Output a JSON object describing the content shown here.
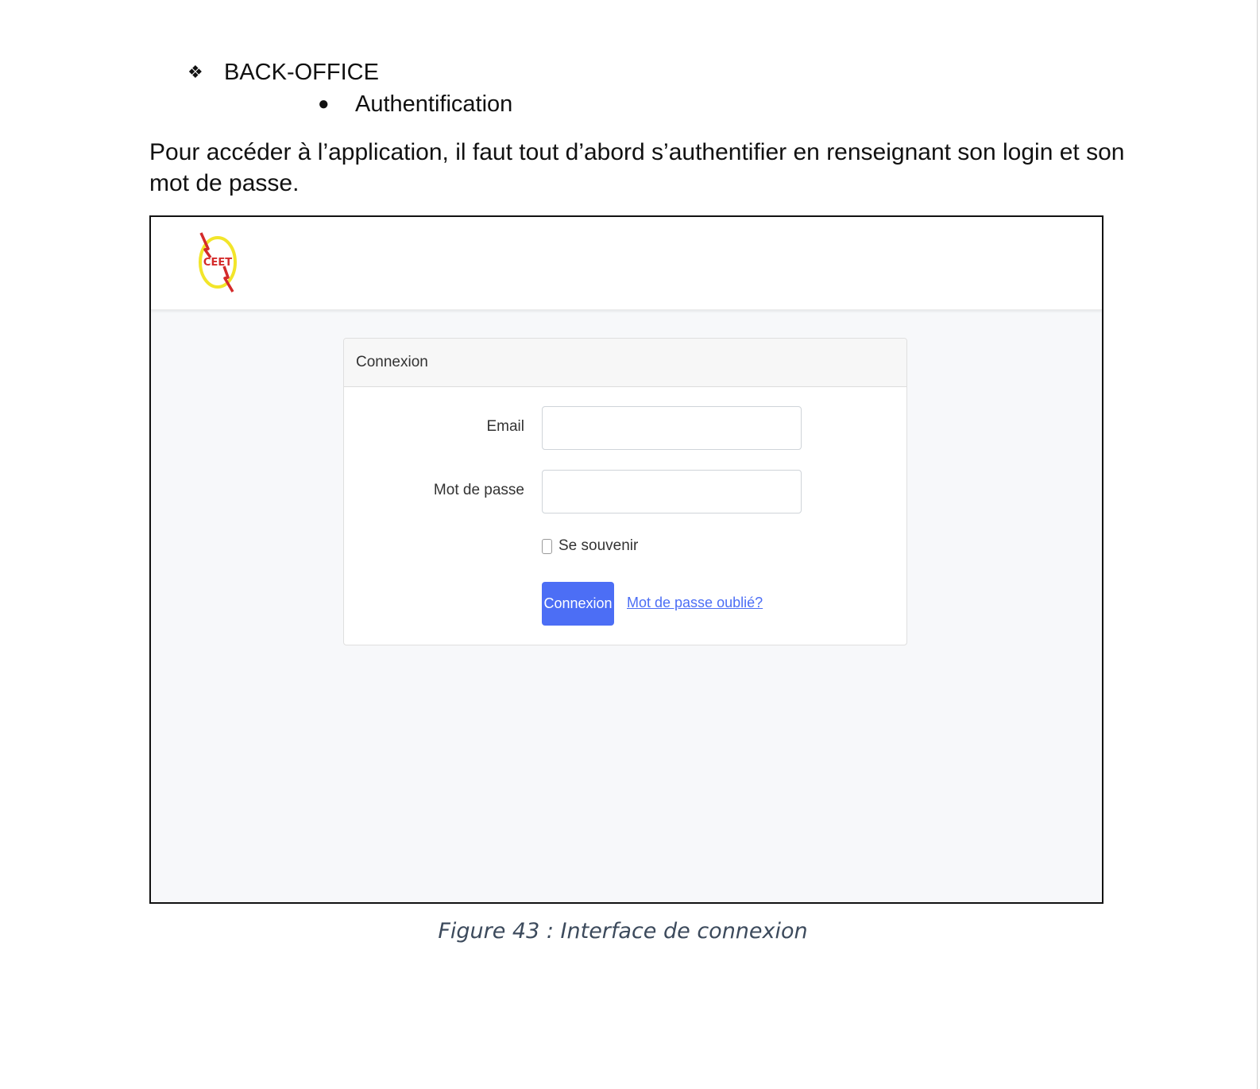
{
  "document": {
    "section_heading": "BACK-OFFICE",
    "subsection_heading": "Authentification",
    "intro_paragraph": "Pour accéder à l’application, il faut tout d’abord s’authentifier en renseignant son login et son mot de passe.",
    "figure_caption": "Figure 43 : Interface de connexion"
  },
  "screenshot": {
    "logo_text": "CEET",
    "login_card": {
      "title": "Connexion",
      "email_label": "Email",
      "email_value": "",
      "password_label": "Mot de passe",
      "password_value": "",
      "remember_label": "Se souvenir",
      "remember_checked": false,
      "submit_label": "Connexion",
      "forgot_link": "Mot de passe oublié?"
    },
    "colors": {
      "primary": "#4c6ef5",
      "page_background": "#f7f8fa",
      "logo_ring": "#f2e52a",
      "logo_bolt": "#d42a2a"
    }
  }
}
